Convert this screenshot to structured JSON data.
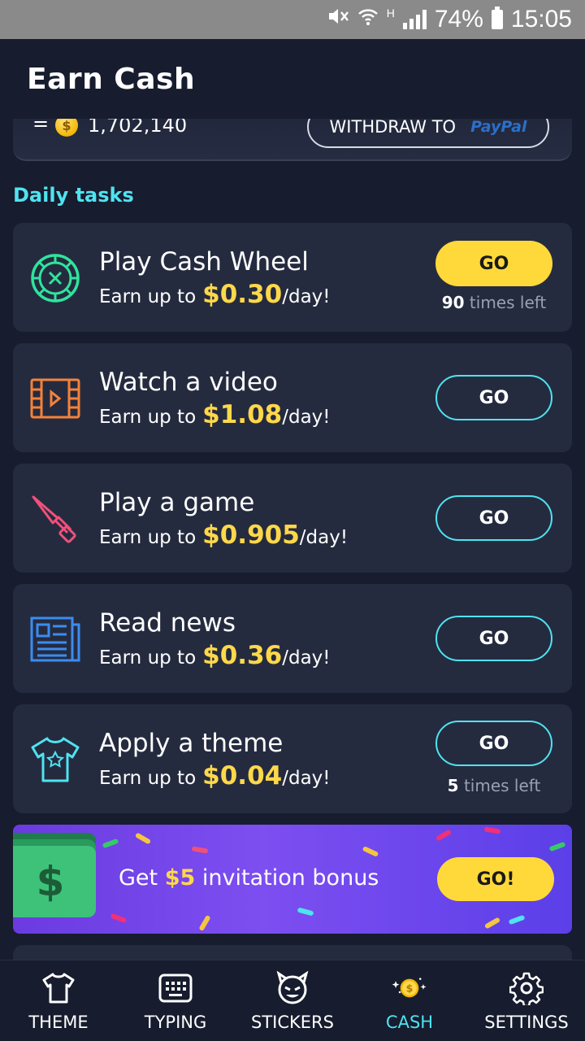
{
  "status_bar": {
    "network_letter": "H",
    "battery": "74%",
    "time": "15:05"
  },
  "header": {
    "title": "Earn Cash"
  },
  "balance": {
    "equals": "=",
    "value": "1,702,140",
    "withdraw_label": "WITHDRAW TO",
    "paypal_label": "PayPal"
  },
  "section_title": "Daily tasks",
  "tasks": [
    {
      "title": "Play Cash Wheel",
      "prefix": "Earn up to",
      "amount": "$0.30",
      "suffix": "/day!",
      "button": "GO",
      "times_count": "90",
      "times_text": "times left",
      "icon": "roulette-wheel-icon",
      "icon_color": "#2ee59d"
    },
    {
      "title": "Watch a video",
      "prefix": "Earn up to",
      "amount": "$1.08",
      "suffix": "/day!",
      "button": "GO",
      "icon": "film-strip-icon",
      "icon_color": "#f5823a"
    },
    {
      "title": "Play a game",
      "prefix": "Earn up to",
      "amount": "$0.905",
      "suffix": "/day!",
      "button": "GO",
      "icon": "knife-icon",
      "icon_color": "#f0507a"
    },
    {
      "title": "Read news",
      "prefix": "Earn up to",
      "amount": "$0.36",
      "suffix": "/day!",
      "button": "GO",
      "icon": "newspaper-icon",
      "icon_color": "#3b8cf0"
    },
    {
      "title": "Apply a theme",
      "prefix": "Earn up to",
      "amount": "$0.04",
      "suffix": "/day!",
      "button": "GO",
      "times_count": "5",
      "times_text": "times left",
      "icon": "tshirt-icon",
      "icon_color": "#4fe3f0"
    }
  ],
  "invite": {
    "prefix": "Get",
    "amount": "$5",
    "suffix": "invitation bonus",
    "button": "GO!",
    "bill_symbol": "$"
  },
  "nav": [
    {
      "label": "THEME",
      "icon": "tshirt-icon"
    },
    {
      "label": "TYPING",
      "icon": "keyboard-icon"
    },
    {
      "label": "STICKERS",
      "icon": "devil-face-icon"
    },
    {
      "label": "CASH",
      "icon": "coin-icon",
      "active": true
    },
    {
      "label": "SETTINGS",
      "icon": "gear-icon"
    }
  ],
  "colors": {
    "background": "#171c2e",
    "card": "#252b3f",
    "accent_cyan": "#4fe3f0",
    "accent_yellow": "#ffd93a"
  }
}
